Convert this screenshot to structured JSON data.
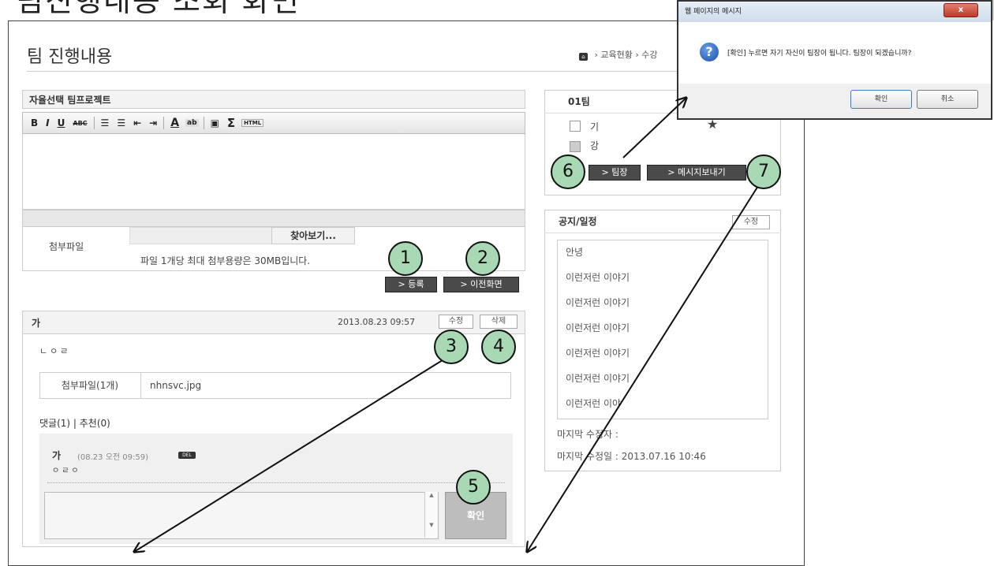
{
  "doc_title": "팀진행내용 조회 화면",
  "page": {
    "title": "팀 진행내용",
    "breadcrumb": [
      "교육현황",
      "수강"
    ]
  },
  "editor": {
    "project_title": "자율선택 팀프로젝트",
    "toolbar": [
      "B",
      "I",
      "U",
      "ABC",
      "☰",
      "☰",
      "⇤",
      "⇥",
      "A",
      "ab",
      "▣",
      "Σ",
      "HTML"
    ],
    "attach_label": "첨부파일",
    "browse_label": "찾아보기...",
    "attach_note": "파일 1개당 최대 첨부용량은 30MB입니다.",
    "register_button": "> 등록",
    "prev_button": "> 이전화면"
  },
  "post": {
    "author": "가",
    "date": "2013.08.23 09:57",
    "edit_button": "수정",
    "delete_button": "삭제",
    "body": "ㄴㅇㄹ",
    "attach_label": "첨부파일(1개)",
    "attach_file": "nhnsvc.jpg",
    "comment_tabs": "댓글(1) | 추천(0)",
    "comment": {
      "author": "가",
      "date": "(08.23 오전 09:59)",
      "badge": "DEL",
      "text": "ㅇㄹㅇ"
    },
    "confirm_button": "확인"
  },
  "team": {
    "title": "01팀",
    "members": [
      {
        "name": "기",
        "checked": false
      },
      {
        "name": "강",
        "checked": true
      }
    ],
    "leader_button": "> 팀장",
    "message_button": "> 메시지보내기"
  },
  "notice": {
    "title": "공지/일정",
    "edit_button": "수정",
    "items": [
      "안녕",
      "이런저런 이야기",
      "이런저런 이야기",
      "이런저런 이야기",
      "이런저런 이야기",
      "이런저런 이야기",
      "이런저런 이야"
    ],
    "last_editor": "마지막 수정자 :",
    "last_edit_date": "마지막 수정일 : 2013.07.16 10:46"
  },
  "dialog": {
    "title": "웹 페이지의 메시지",
    "close": "x",
    "message": "[확인] 누르면 자기 자신이 팀장이 됩니다. 팀장이 되겠습니까?",
    "ok_button": "확인",
    "cancel_button": "취소"
  },
  "markers": [
    "1",
    "2",
    "3",
    "4",
    "5",
    "6",
    "7"
  ],
  "colors": {
    "marker": "#a8d8b4",
    "dark_button": "#4a4a4a"
  }
}
